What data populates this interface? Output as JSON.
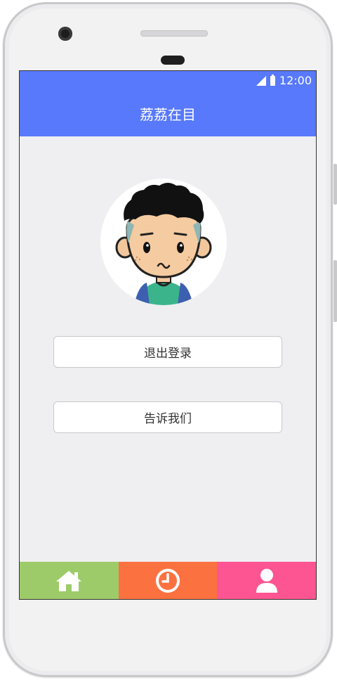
{
  "status_bar": {
    "time": "12:00"
  },
  "app_bar": {
    "title": "荔荔在目"
  },
  "actions": {
    "logout_label": "退出登录",
    "feedback_label": "告诉我们"
  },
  "tab_bar": {
    "items": [
      {
        "icon": "home-icon",
        "color": "#9ecb69"
      },
      {
        "icon": "clock-icon",
        "color": "#fb7240"
      },
      {
        "icon": "user-icon",
        "color": "#fc5591"
      }
    ]
  },
  "colors": {
    "primary": "#5879fb",
    "background": "#efeff1"
  }
}
